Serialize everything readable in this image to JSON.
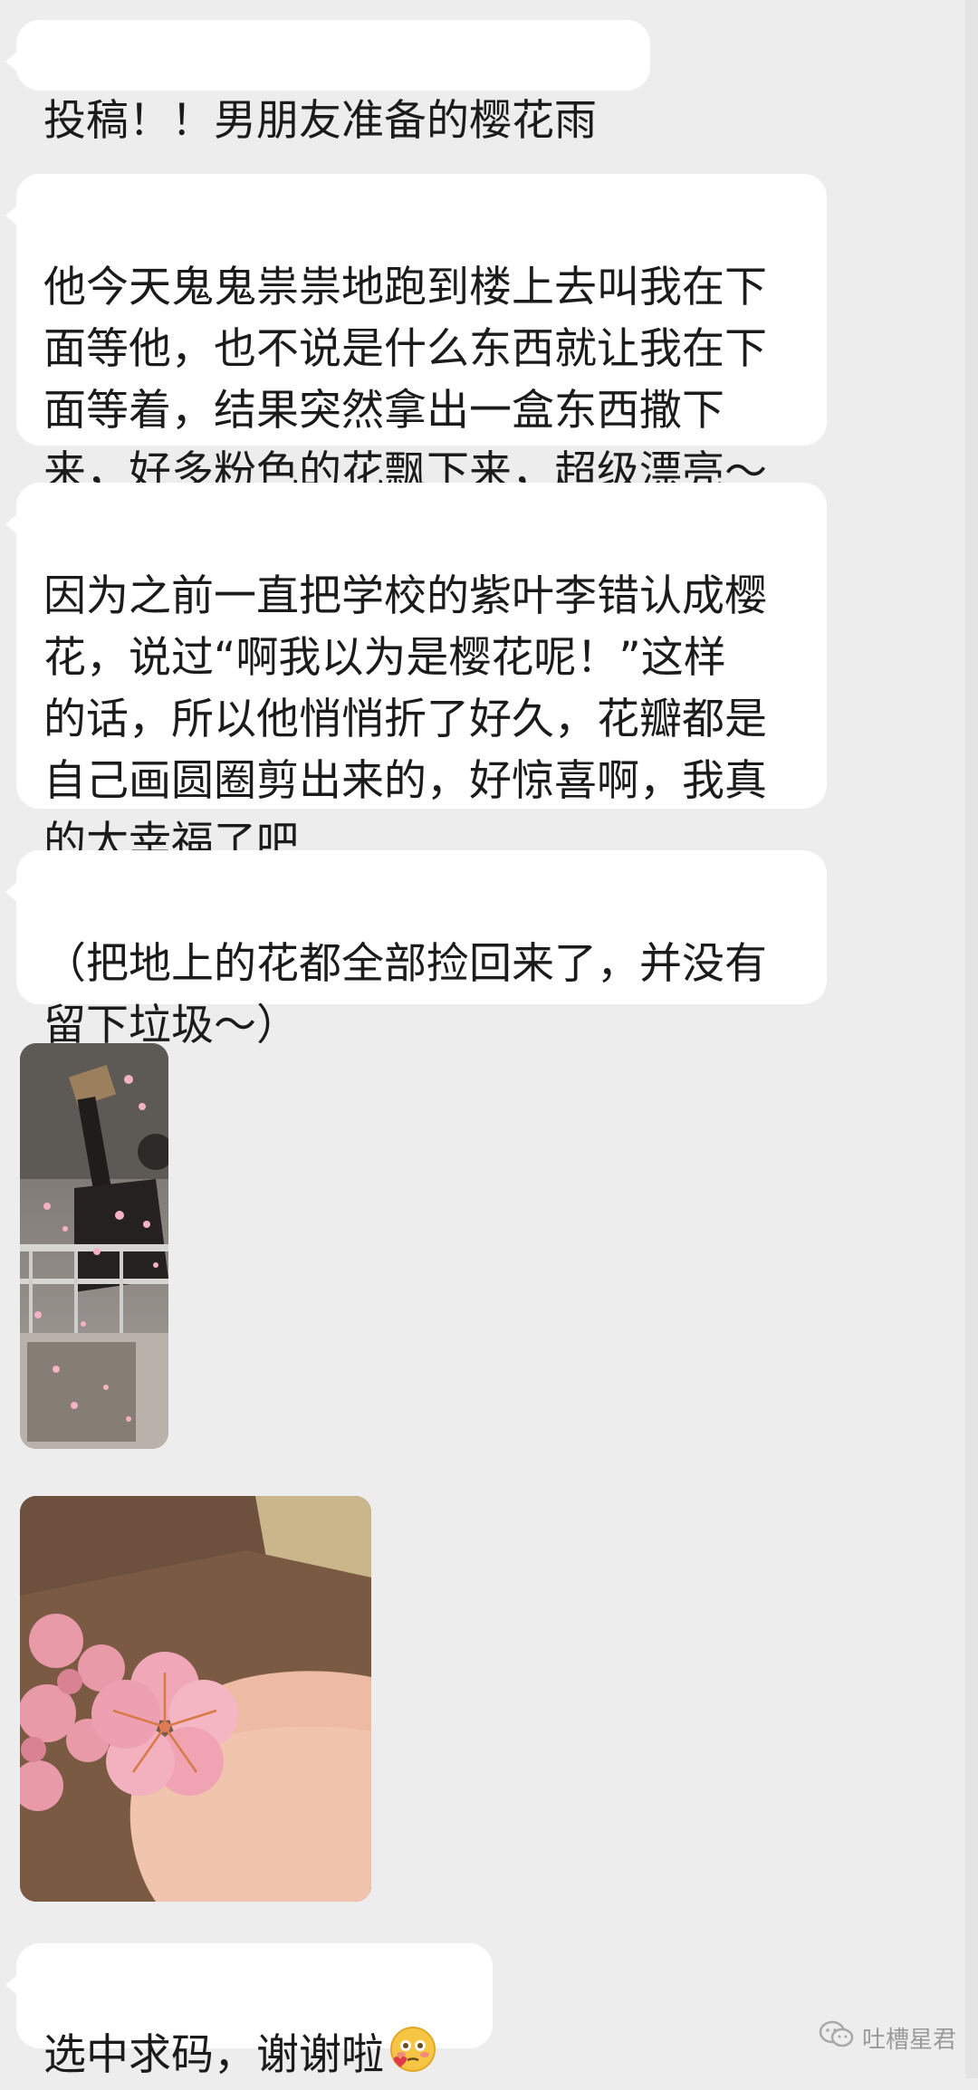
{
  "messages": [
    {
      "type": "text",
      "text": "投稿！！男朋友准备的樱花雨"
    },
    {
      "type": "text",
      "text": "他今天鬼鬼祟祟地跑到楼上去叫我在下\n面等他，也不说是什么东西就让我在下\n面等着，结果突然拿出一盒东西撒下\n来，好多粉色的花飘下来，超级漂亮～"
    },
    {
      "type": "text",
      "text": "因为之前一直把学校的紫叶李错认成樱\n花，说过“啊我以为是樱花呢！”这样\n的话，所以他悄悄折了好久，花瓣都是\n自己画圆圈剪出来的，好惊喜啊，我真\n的太幸福了吧"
    },
    {
      "type": "text",
      "text": "（把地上的花都全部捡回来了，并没有\n留下垃圾～）"
    },
    {
      "type": "image",
      "description_icon": "photo-cherry-blossom-rain"
    },
    {
      "type": "image",
      "description_icon": "photo-paper-flower-in-hand"
    },
    {
      "type": "text",
      "text": "选中求码，谢谢啦",
      "emoji": "blushing-face-emoji"
    }
  ],
  "watermark": {
    "text": "吐槽星君",
    "icon": "wechat-icon"
  },
  "colors": {
    "background": "#ededed",
    "bubble": "#ffffff",
    "text": "#1b1b1b"
  }
}
